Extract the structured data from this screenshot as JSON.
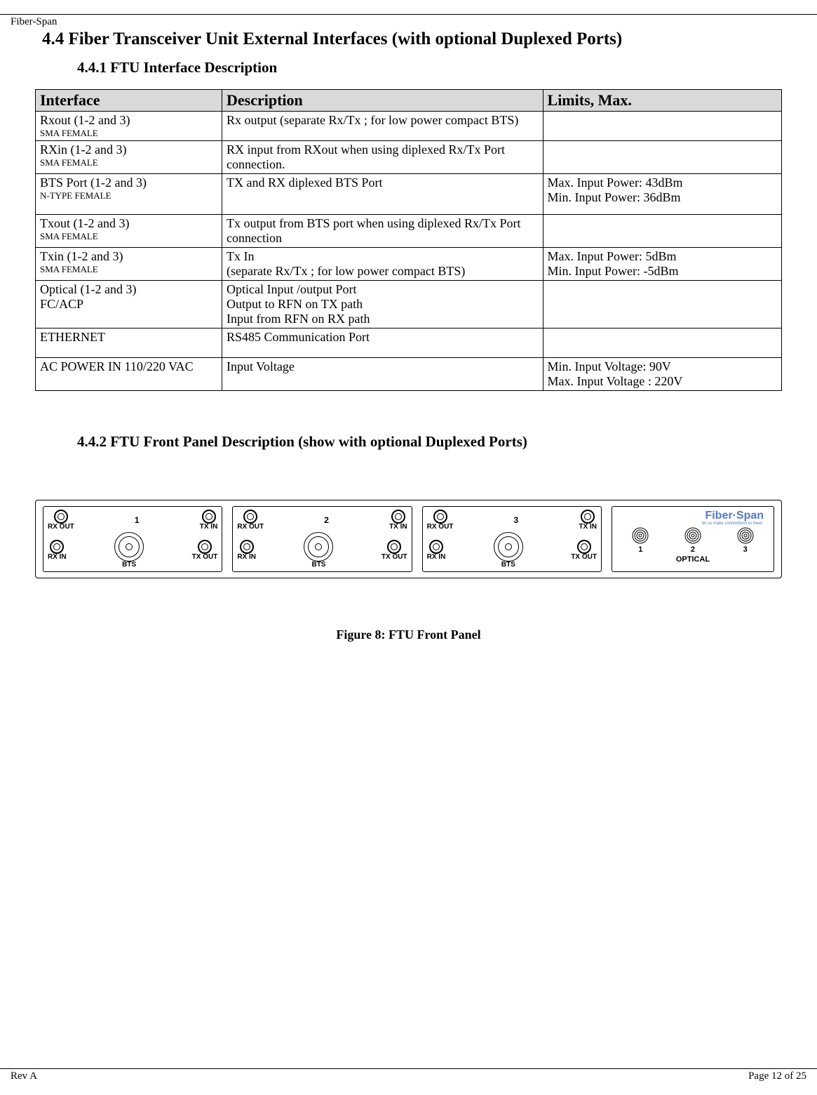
{
  "header": {
    "brand": "Fiber-Span"
  },
  "section": {
    "number_title": "4.4 Fiber Transceiver Unit External Interfaces (with optional Duplexed Ports)",
    "sub1": "4.4.1   FTU Interface Description",
    "sub2": "4.4.2    FTU Front Panel Description (show with optional  Duplexed Ports)"
  },
  "table": {
    "headers": {
      "c1": "Interface",
      "c2": "Description",
      "c3": "Limits, Max."
    },
    "rows": [
      {
        "iface_main": "Rxout  (1-2 and 3)",
        "iface_sub": "SMA FEMALE",
        "desc": "Rx output (separate Rx/Tx ; for low power compact BTS)",
        "limits": ""
      },
      {
        "iface_main": "RXin (1-2 and 3)",
        "iface_sub": "SMA FEMALE",
        "desc": "RX input from RXout when using diplexed Rx/Tx Port connection.",
        "limits": ""
      },
      {
        "iface_main": "BTS Port  (1-2 and 3)",
        "iface_sub": "N-TYPE FEMALE",
        "desc": "TX and RX diplexed BTS Port",
        "limits": "Max. Input Power: 43dBm\nMin. Input Power: 36dBm"
      },
      {
        "iface_main": "Txout (1-2 and 3)",
        "iface_sub": "SMA FEMALE",
        "desc": "Tx output from BTS port when using diplexed Rx/Tx Port connection",
        "limits": ""
      },
      {
        "iface_main": "Txin (1-2 and 3)",
        "iface_sub": "SMA FEMALE",
        "desc": "Tx In\n(separate Rx/Tx ; for low power compact BTS)",
        "limits": "Max. Input Power: 5dBm\nMin. Input Power: -5dBm"
      },
      {
        "iface_main": "Optical (1-2 and 3)",
        "iface_sub2": "FC/ACP",
        "desc": "Optical Input /output Port\nOutput to RFN on TX path\nInput from RFN on RX path",
        "limits": ""
      },
      {
        "iface_main": "ETHERNET",
        "iface_sub": "",
        "desc": "RS485 Communication Port",
        "limits": ""
      },
      {
        "iface_main": "AC POWER IN 110/220 VAC",
        "iface_sub": "",
        "desc": "Input Voltage",
        "limits": "Min. Input Voltage: 90V\nMax. Input Voltage : 220V"
      }
    ]
  },
  "panel": {
    "modules": [
      {
        "num": "1",
        "rxout": "RX OUT",
        "txin": "TX IN",
        "rxin": "RX IN",
        "txout": "TX OUT",
        "bts": "BTS"
      },
      {
        "num": "2",
        "rxout": "RX OUT",
        "txin": "TX IN",
        "rxin": "RX IN",
        "txout": "TX OUT",
        "bts": "BTS"
      },
      {
        "num": "3",
        "rxout": "RX OUT",
        "txin": "TX IN",
        "rxin": "RX IN",
        "txout": "TX OUT",
        "bts": "BTS"
      }
    ],
    "optical": {
      "logo": "Fiber·Span",
      "tagline": "let us make connections to meet",
      "nums": [
        "1",
        "2",
        "3"
      ],
      "label": "OPTICAL"
    }
  },
  "figure_caption": "Figure 8: FTU Front Panel",
  "footer": {
    "left": "Rev A",
    "right": "Page 12 of 25"
  }
}
